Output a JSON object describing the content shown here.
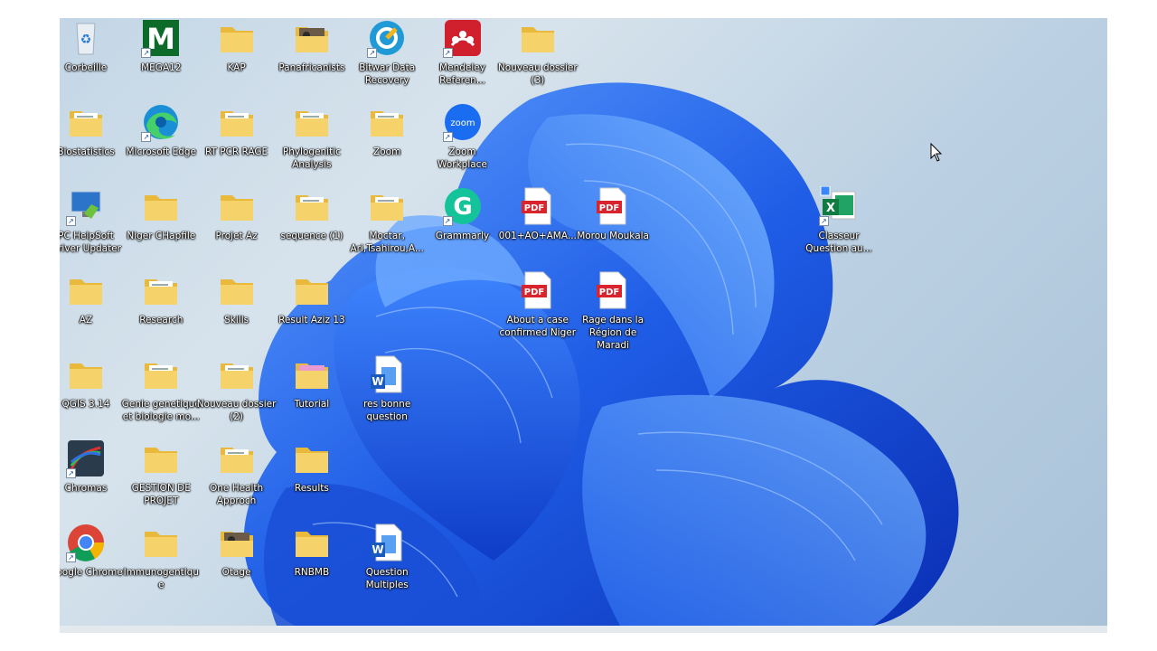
{
  "desktop": {
    "icons": [
      {
        "label": "Corbeille",
        "kind": "recycle",
        "col": 0,
        "row": 0
      },
      {
        "label": "MEGA12",
        "kind": "mega",
        "col": 1,
        "row": 0
      },
      {
        "label": "KAP",
        "kind": "folder",
        "col": 2,
        "row": 0
      },
      {
        "label": "Panafricanists",
        "kind": "folder-photo",
        "col": 3,
        "row": 0
      },
      {
        "label": "Bitwar Data\nRecovery",
        "kind": "bitwar",
        "col": 4,
        "row": 0
      },
      {
        "label": "Mendeley\nReferen...",
        "kind": "mendeley",
        "col": 5,
        "row": 0
      },
      {
        "label": "Nouveau dossier\n(3)",
        "kind": "folder",
        "col": 6,
        "row": 0
      },
      {
        "label": "Biostatistics",
        "kind": "folder-doc",
        "col": 0,
        "row": 1
      },
      {
        "label": "Microsoft Edge",
        "kind": "edge",
        "col": 1,
        "row": 1
      },
      {
        "label": "RT PCR RAGE",
        "kind": "folder-doc",
        "col": 2,
        "row": 1
      },
      {
        "label": "Phylogenitic\nAnalysis",
        "kind": "folder-doc",
        "col": 3,
        "row": 1
      },
      {
        "label": "Zoom",
        "kind": "folder-doc",
        "col": 4,
        "row": 1
      },
      {
        "label": "Zoom Workplace",
        "kind": "zoom",
        "col": 5,
        "row": 1
      },
      {
        "label": "PC HelpSoft\nDriver Updater",
        "kind": "helpsoft",
        "col": 0,
        "row": 2
      },
      {
        "label": "Niger CHapfile",
        "kind": "folder",
        "col": 1,
        "row": 2
      },
      {
        "label": "Projet Az",
        "kind": "folder",
        "col": 2,
        "row": 2
      },
      {
        "label": "sequence (1)",
        "kind": "folder-doc",
        "col": 3,
        "row": 2
      },
      {
        "label": "Moctar,\nAri,Tsahirou,A...",
        "kind": "folder-doc",
        "col": 4,
        "row": 2
      },
      {
        "label": "Grammarly",
        "kind": "grammarly",
        "col": 5,
        "row": 2
      },
      {
        "label": "001+AO+AMA...",
        "kind": "pdf",
        "col": 6,
        "row": 2
      },
      {
        "label": "Morou Moukala",
        "kind": "pdf",
        "col": 7,
        "row": 2
      },
      {
        "label": "Classeur\nQuestion au...",
        "kind": "excel",
        "col": 10,
        "row": 2
      },
      {
        "label": "AZ",
        "kind": "folder",
        "col": 0,
        "row": 3
      },
      {
        "label": "Research",
        "kind": "folder-doc",
        "col": 1,
        "row": 3
      },
      {
        "label": "Skills",
        "kind": "folder",
        "col": 2,
        "row": 3
      },
      {
        "label": "Result Aziz 13",
        "kind": "folder",
        "col": 3,
        "row": 3
      },
      {
        "label": "About a case\nconfirmed Niger",
        "kind": "pdf",
        "col": 6,
        "row": 3
      },
      {
        "label": "Rage dans la\nRégion de Maradi",
        "kind": "pdf",
        "col": 7,
        "row": 3
      },
      {
        "label": "QGIS 3.14",
        "kind": "folder",
        "col": 0,
        "row": 4
      },
      {
        "label": "Genie genetique\net biologie mo...",
        "kind": "folder-doc",
        "col": 1,
        "row": 4
      },
      {
        "label": "Nouveau dossier\n(2)",
        "kind": "folder-doc",
        "col": 2,
        "row": 4
      },
      {
        "label": "Tutorial",
        "kind": "folder-pink",
        "col": 3,
        "row": 4
      },
      {
        "label": "res bonne\nquestion",
        "kind": "word",
        "col": 4,
        "row": 4
      },
      {
        "label": "Chromas",
        "kind": "chromas",
        "col": 0,
        "row": 5
      },
      {
        "label": "GESTION DE\nPROJET",
        "kind": "folder",
        "col": 1,
        "row": 5
      },
      {
        "label": "One Health\nApproch",
        "kind": "folder-doc",
        "col": 2,
        "row": 5
      },
      {
        "label": "Results",
        "kind": "folder",
        "col": 3,
        "row": 5
      },
      {
        "label": "Google Chrome",
        "kind": "chrome",
        "col": 0,
        "row": 6
      },
      {
        "label": "Immunogentique",
        "kind": "folder",
        "col": 1,
        "row": 6
      },
      {
        "label": "Otage",
        "kind": "folder-photo",
        "col": 2,
        "row": 6
      },
      {
        "label": "RNBMB",
        "kind": "folder",
        "col": 3,
        "row": 6
      },
      {
        "label": "Question\nMultiples",
        "kind": "word",
        "col": 4,
        "row": 6
      }
    ]
  }
}
